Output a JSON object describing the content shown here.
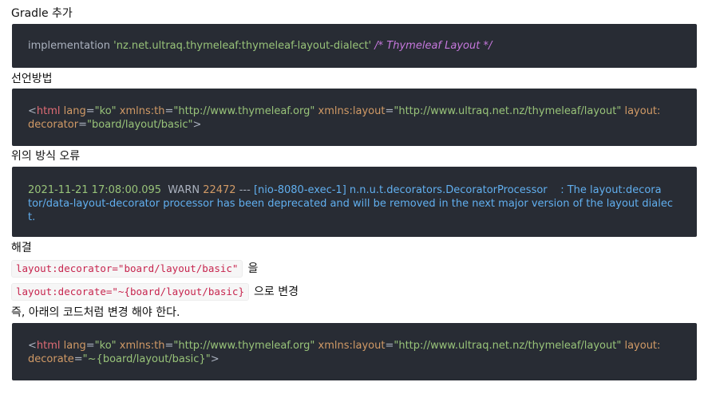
{
  "sections": {
    "gradle": {
      "heading": "Gradle 추가",
      "code": {
        "keyword": "implementation",
        "string": "'nz.net.ultraq.thymeleaf:thymeleaf-layout-dialect'",
        "comment": "/* Thymeleaf Layout */"
      }
    },
    "declare": {
      "heading": "선언방법",
      "line1": {
        "open": "<",
        "tag": "html",
        "attr1": "lang",
        "eq1": "=",
        "val1": "\"ko\"",
        "attr2": "xmlns:th",
        "eq2": "=",
        "val2": "\"http://www.thymeleaf.org\"",
        "attr3": "xmlns:layout",
        "eq3": "=",
        "val3": "\"http://www.ultraq.net.nz/thymeleaf/layout\"",
        "attr4a": "layout:"
      },
      "line2": {
        "attr4b": "decorator",
        "eq4": "=",
        "val4": "\"board/layout/basic\"",
        "close": ">"
      }
    },
    "error": {
      "heading": "위의 방식 오류",
      "line1": {
        "datetime": "2021-11-21 17:08:00.095",
        "level": "WARN",
        "pid": "22472",
        "sep": "---",
        "thread": "[nio-8080-exec-1]",
        "logger": "n.n.u.t.decorators.DecoratorProcessor",
        "msg_a": ": The layout:decora"
      },
      "line2": {
        "msg_b": "tor/data-layout-decorator processor has been deprecated and will be removed in the next major version of the layout dialec"
      },
      "line3": {
        "msg_c": "t."
      }
    },
    "fix": {
      "heading": "해결",
      "row1": {
        "code": "layout:decorator=\"board/layout/basic\"",
        "suffix": "을"
      },
      "row2": {
        "code": "layout:decorate=\"~{board/layout/basic}",
        "suffix": "으로 변경"
      },
      "summary": "즉, 아래의 코드처럼 변경 해야 한다."
    },
    "result": {
      "line1": {
        "open": "<",
        "tag": "html",
        "attr1": "lang",
        "eq1": "=",
        "val1": "\"ko\"",
        "attr2": "xmlns:th",
        "eq2": "=",
        "val2": "\"http://www.thymeleaf.org\"",
        "attr3": "xmlns:layout",
        "eq3": "=",
        "val3": "\"http://www.ultraq.net.nz/thymeleaf/layout\"",
        "attr4a": "layout:"
      },
      "line2": {
        "attr4b": "decorate",
        "eq4": "=",
        "val4": "\"~{board/layout/basic}\"",
        "close": ">"
      }
    }
  },
  "colors": {
    "code_bg": "#282c34",
    "tag": "#e06c75",
    "attr": "#d19a66",
    "string": "#98c379",
    "comment": "#c678dd",
    "log_message": "#61afef",
    "inline_code_text": "#c7254e"
  }
}
